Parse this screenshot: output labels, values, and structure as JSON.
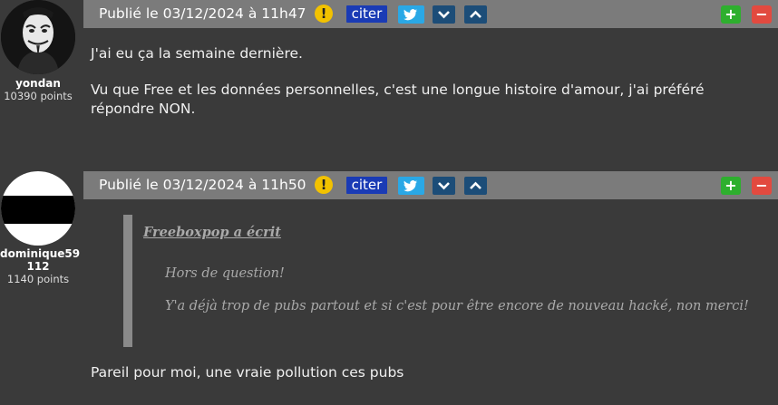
{
  "posts": [
    {
      "author": {
        "name": "yondan",
        "points": "10390 points"
      },
      "date": "Publié le 03/12/2024 à 11h47",
      "actions": {
        "warn": "!",
        "quote": "citer",
        "plus": "+",
        "minus": "−"
      },
      "paragraphs": [
        "J'ai eu ça la semaine dernière.",
        "Vu que Free et les données personnelles, c'est une longue histoire d'amour, j'ai préféré répondre NON."
      ]
    },
    {
      "author": {
        "name": "dominique59",
        "name_line2": "112",
        "points": "1140 points"
      },
      "date": "Publié le 03/12/2024 à 11h50",
      "actions": {
        "warn": "!",
        "quote": "citer",
        "plus": "+",
        "minus": "−"
      },
      "quote": {
        "author": "Freeboxpop a écrit",
        "lines": [
          "Hors de question!",
          "Y'a déjà trop de pubs partout et si c'est pour être encore de nouveau hacké, non merci!"
        ]
      },
      "paragraphs": [
        "Pareil pour moi, une vraie pollution ces pubs"
      ]
    }
  ],
  "icons": {
    "warn": "warning-icon",
    "twitter": "twitter-icon",
    "down": "chevron-down-icon",
    "up": "chevron-up-icon"
  }
}
